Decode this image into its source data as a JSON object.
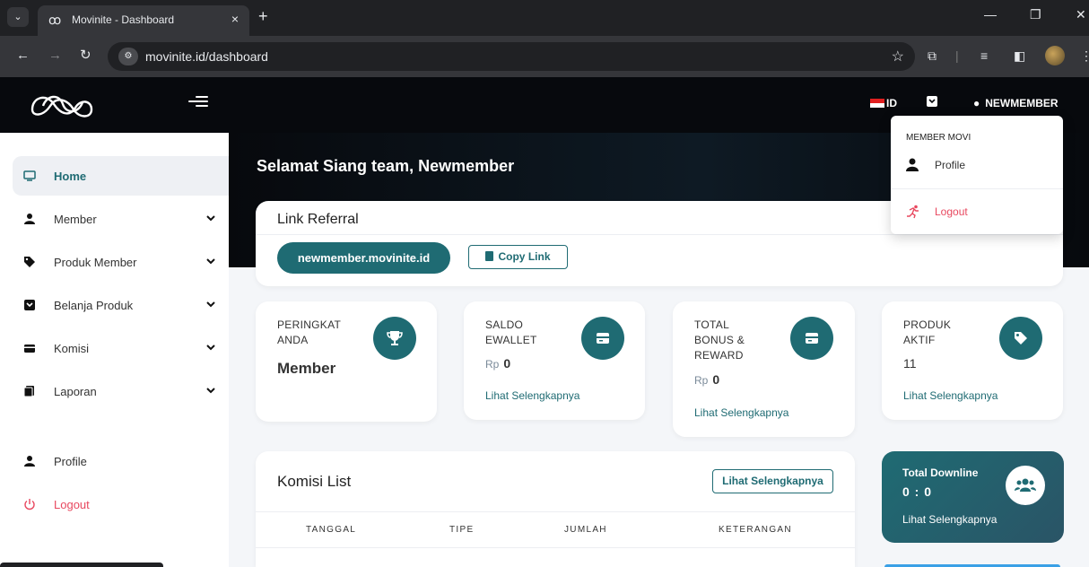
{
  "browser": {
    "tab_title": "Movinite - Dashboard",
    "tab_close": "×",
    "new_tab": "+",
    "url": "movinite.id/dashboard"
  },
  "header": {
    "language": "ID",
    "user_name": "NEWMEMBER"
  },
  "sidebar": {
    "items": [
      {
        "label": "Home",
        "icon": "monitor-icon",
        "active": true
      },
      {
        "label": "Member",
        "icon": "user-icon"
      },
      {
        "label": "Produk Member",
        "icon": "tag-icon"
      },
      {
        "label": "Belanja Produk",
        "icon": "cart-icon"
      },
      {
        "label": "Komisi",
        "icon": "card-icon"
      },
      {
        "label": "Laporan",
        "icon": "report-icon"
      }
    ],
    "profile_label": "Profile",
    "logout_label": "Logout"
  },
  "main": {
    "greeting_prefix": "Selamat Siang team, ",
    "greeting_name": "Newmember",
    "referral": {
      "title": "Link Referral",
      "link": "newmember.movinite.id",
      "copy_label": "Copy Link"
    },
    "stats": [
      {
        "label_line1": "PERINGKAT",
        "label_line2": "ANDA",
        "value": "Member",
        "icon": "trophy-icon"
      },
      {
        "label_line1": "SALDO",
        "label_line2": "EWALLET",
        "currency": "Rp",
        "value": "0",
        "link": "Lihat Selengkapnya",
        "icon": "wallet-icon"
      },
      {
        "label_line1": "TOTAL",
        "label_line2": "BONUS &",
        "label_line3": "REWARD",
        "currency": "Rp",
        "value": "0",
        "link": "Lihat Selengkapnya",
        "icon": "wallet-icon"
      },
      {
        "label_line1": "PRODUK",
        "label_line2": "AKTIF",
        "value": "11",
        "link": "Lihat Selengkapnya",
        "icon": "tag-icon"
      }
    ],
    "komisi": {
      "title": "Komisi List",
      "more_label": "Lihat Selengkapnya",
      "columns": [
        "TANGGAL",
        "TIPE",
        "JUMLAH",
        "KETERANGAN"
      ]
    },
    "downline": {
      "title": "Total Downline",
      "value": "0 : 0",
      "link": "Lihat Selengkapnya"
    }
  },
  "dropdown": {
    "header": "MEMBER MOVI",
    "profile_label": "Profile",
    "logout_label": "Logout"
  },
  "colors": {
    "accent": "#1f6b73",
    "danger": "#e8485f",
    "header_bg": "#07090d"
  }
}
